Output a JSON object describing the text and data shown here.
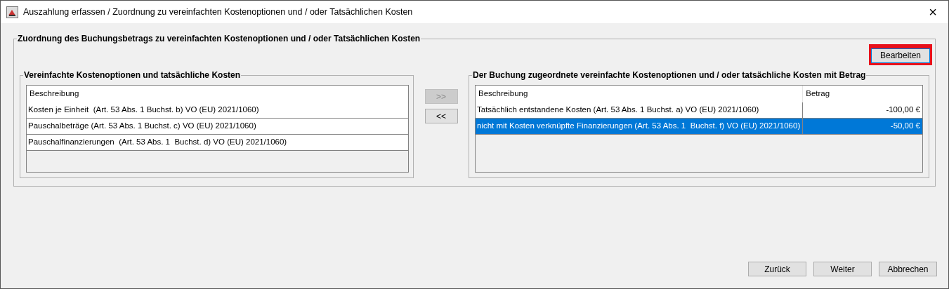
{
  "window": {
    "title": "Auszahlung erfassen / Zuordnung zu vereinfachten Kostenoptionen und / oder Tatsächlichen Kosten",
    "close": "×"
  },
  "group": {
    "title": "Zuordnung des Buchungsbetrags zu vereinfachten Kostenoptionen und / oder Tatsächlichen Kosten",
    "edit_button": {
      "label": "Bearbeiten",
      "highlighted": true
    },
    "available": {
      "title": "Vereinfachte Kostenoptionen und tatsächliche Kosten",
      "columns": [
        "Beschreibung"
      ],
      "rows": [
        {
          "cells": [
            "Kosten je Einheit  (Art. 53 Abs. 1 Buchst. b) VO (EU) 2021/1060)"
          ],
          "selected": false
        },
        {
          "cells": [
            "Pauschalbeträge (Art. 53 Abs. 1 Buchst. c) VO (EU) 2021/1060)"
          ],
          "selected": false
        },
        {
          "cells": [
            "Pauschalfinanzierungen  (Art. 53 Abs. 1  Buchst. d) VO (EU) 2021/1060)"
          ],
          "selected": false
        }
      ]
    },
    "move_buttons": [
      {
        "label": ">>",
        "disabled": true
      },
      {
        "label": "<<",
        "disabled": false
      }
    ],
    "assigned": {
      "title": "Der Buchung zugeordnete vereinfachte Kostenoptionen und / oder tatsächliche Kosten mit Betrag",
      "columns": [
        "Beschreibung",
        "Betrag"
      ],
      "rows": [
        {
          "cells": [
            "Tatsächlich entstandene Kosten (Art. 53 Abs. 1 Buchst. a) VO (EU) 2021/1060)",
            "-100,00 €"
          ],
          "selected": false
        },
        {
          "cells": [
            "nicht mit Kosten verknüpfte Finanzierungen (Art. 53 Abs. 1  Buchst. f) VO (EU) 2021/1060)",
            "-50,00 €"
          ],
          "selected": true
        }
      ]
    }
  },
  "footer_buttons": [
    "Zurück",
    "Weiter",
    "Abbrechen"
  ]
}
